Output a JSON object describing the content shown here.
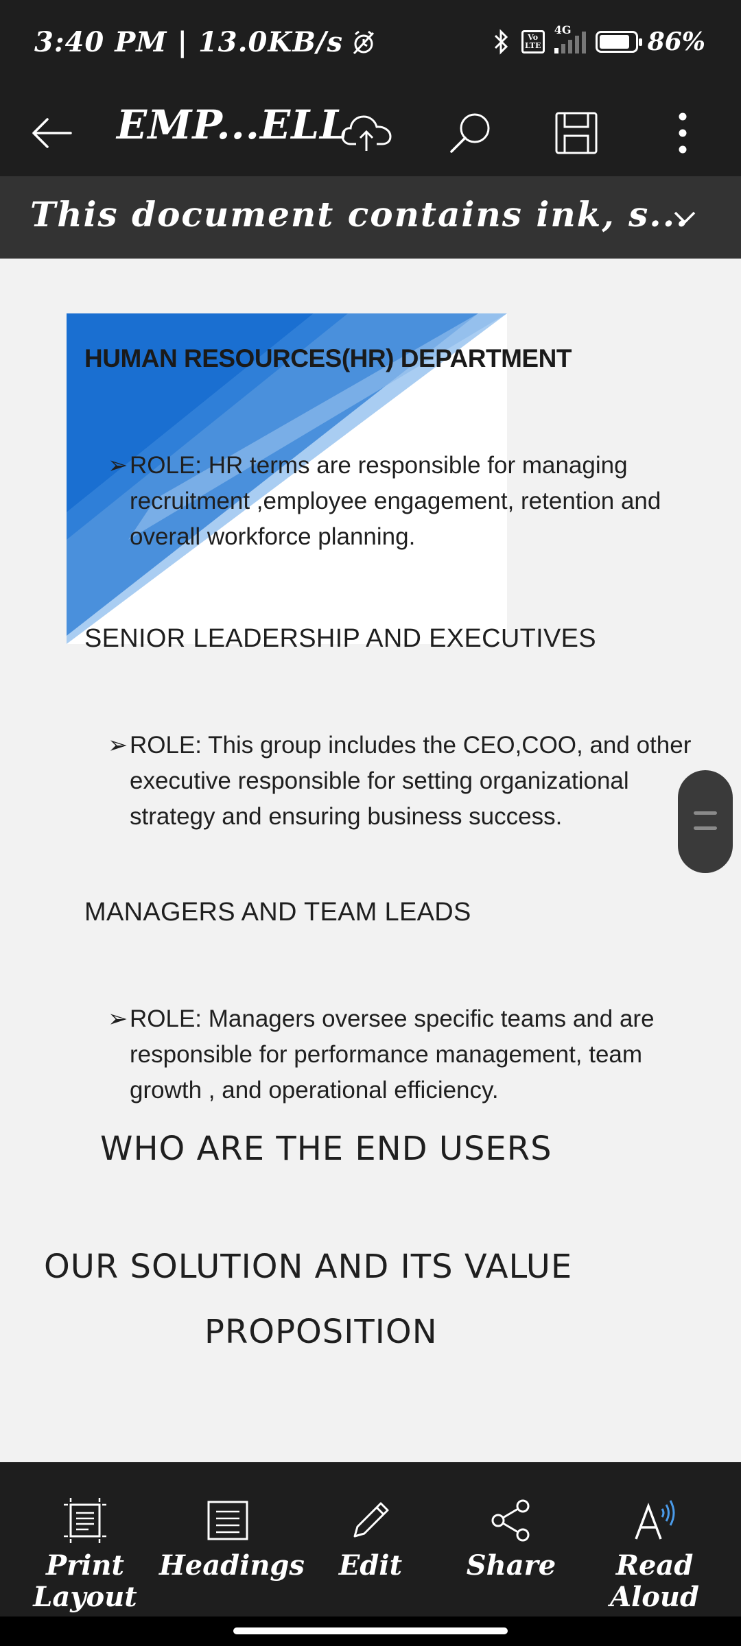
{
  "status": {
    "time_speed": "3:40 PM | 13.0KB/s",
    "volte_top": "Vo",
    "volte_bottom": "LTE",
    "network": "4G",
    "battery": "86%",
    "battery_level": 0.86
  },
  "toolbar": {
    "title": "EMP...ELL"
  },
  "banner": {
    "text": "This document contains ink, s..."
  },
  "document": {
    "hr_heading": "HUMAN RESOURCES(HR) DEPARTMENT",
    "bullet_marker": "➢",
    "hr_role": "ROLE: HR terms are responsible for managing recruitment ,employee engagement, retention and overall workforce planning.",
    "senior_heading": "SENIOR LEADERSHIP AND EXECUTIVES",
    "senior_role": "ROLE: This group includes the CEO,COO, and other executive responsible for setting organizational strategy and ensuring business success.",
    "managers_heading": "MANAGERS AND TEAM LEADS",
    "managers_role": "ROLE: Managers oversee specific teams and are responsible for performance management, team growth , and operational efficiency.",
    "end_users_heading": "WHO ARE THE END USERS",
    "solution_heading_line1": "OUR SOLUTION AND ITS VALUE",
    "solution_heading_line2": "PROPOSITION"
  },
  "colors": {
    "dark_blue": "#1a6fd1",
    "mid_blue": "#4a90dc",
    "light_blue": "#a9cdf2"
  },
  "bottom_bar": {
    "print_layout": {
      "line1": "Print",
      "line2": "Layout",
      "icon": "print-layout-icon"
    },
    "headings": {
      "label": "Headings",
      "icon": "headings-icon"
    },
    "edit": {
      "label": "Edit",
      "icon": "pencil-icon"
    },
    "share": {
      "label": "Share",
      "icon": "share-icon"
    },
    "read_aloud": {
      "line1": "Read",
      "line2": "Aloud",
      "icon": "read-aloud-icon"
    }
  }
}
